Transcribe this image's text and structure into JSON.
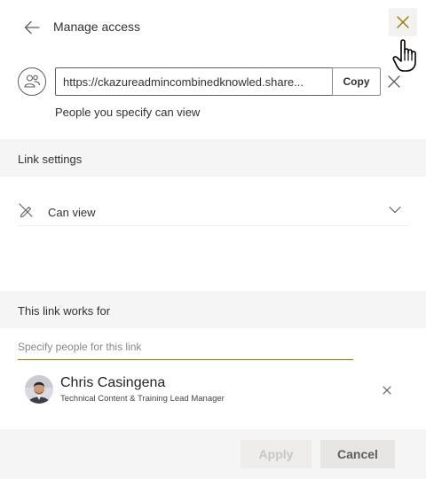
{
  "header": {
    "title": "Manage access"
  },
  "link": {
    "url": "https://ckazureadmincombinedknowled.share...",
    "copy_label": "Copy",
    "audience_text": "People you specify can view"
  },
  "link_settings": {
    "section_label": "Link settings",
    "permission_label": "Can view"
  },
  "works_for": {
    "section_label": "This link works for",
    "input_placeholder": "Specify people for this link",
    "people": [
      {
        "name": "Chris Casingena",
        "role": "Technical Content & Training Lead Manager"
      }
    ]
  },
  "footer": {
    "apply_label": "Apply",
    "cancel_label": "Cancel"
  },
  "colors": {
    "accent_underline": "#8f7a00",
    "close_hover_bg": "#f3f2f1",
    "section_bg": "#f5f5f5",
    "apply_disabled_text": "#c8c6c4"
  },
  "icons": [
    "back-arrow-icon",
    "close-icon",
    "people-link-icon",
    "remove-link-icon",
    "edit-off-icon",
    "chevron-down-icon",
    "remove-person-icon",
    "hand-cursor-icon"
  ]
}
